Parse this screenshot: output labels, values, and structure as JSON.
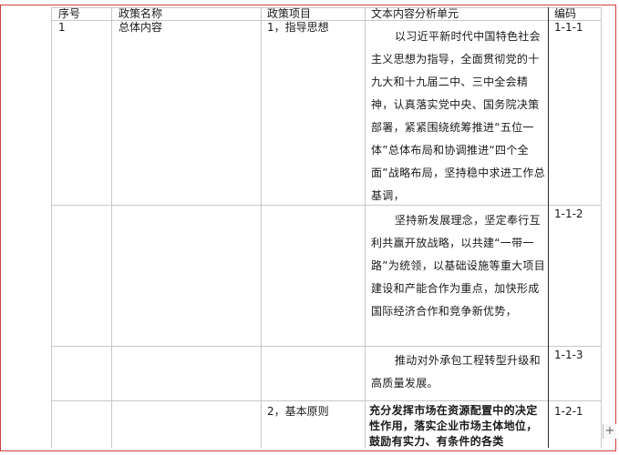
{
  "table": {
    "headers": [
      "序号",
      "政策名称",
      "政策项目",
      "文本内容分析单元",
      "编码"
    ],
    "rows": [
      {
        "seq": "1",
        "name": "总体内容",
        "item": "1，指导思想",
        "text": "以习近平新时代中国特色社会主义思想为指导，全面贯彻党的十九大和十九届二中、三中全会精神，认真落实党中央、国务院决策部署，紧紧围绕统筹推进“五位一体”总体布局和协调推进“四个全面”战略布局，坚持稳中求进工作总基调，",
        "code": "1-1-1"
      },
      {
        "seq": "",
        "name": "",
        "item": "",
        "text": "坚持新发展理念，坚定奉行互利共赢开放战略，以共建“一带一路”为统领，以基础设施等重大项目建设和产能合作为重点，加快形成国际经济合作和竞争新优势，",
        "code": "1-1-2"
      },
      {
        "seq": "",
        "name": "",
        "item": "",
        "text": "推动对外承包工程转型升级和高质量发展。",
        "code": "1-1-3"
      },
      {
        "seq": "",
        "name": "",
        "item": "2，基本原则",
        "text": "充分发挥市场在资源配置中的决定性作用，落实企业市场主体地位，鼓励有实力、有条件的各类",
        "code": "1-2-1"
      }
    ]
  },
  "scroll_control": "+"
}
